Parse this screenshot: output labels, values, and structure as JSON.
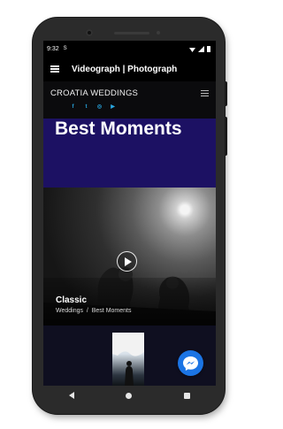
{
  "status": {
    "time": "9:32",
    "badge": "S"
  },
  "appbar": {
    "title": "Videograph | Photograph"
  },
  "site": {
    "brand": "CROATIA WEDDINGS",
    "socials": [
      {
        "icon": "facebook-icon",
        "glyph": "f"
      },
      {
        "icon": "twitter-icon",
        "glyph": "t"
      },
      {
        "icon": "instagram-icon",
        "glyph": "◎"
      },
      {
        "icon": "youtube-icon",
        "glyph": "▶"
      }
    ]
  },
  "hero": {
    "title": "Best Moments"
  },
  "card": {
    "title": "Classic",
    "breadcrumb": {
      "first": "Weddings",
      "sep": "/",
      "second": "Best Moments"
    }
  },
  "colors": {
    "accent": "#29a7e1",
    "hero_bg": "#1c1163",
    "messenger": "#1b74e4"
  }
}
